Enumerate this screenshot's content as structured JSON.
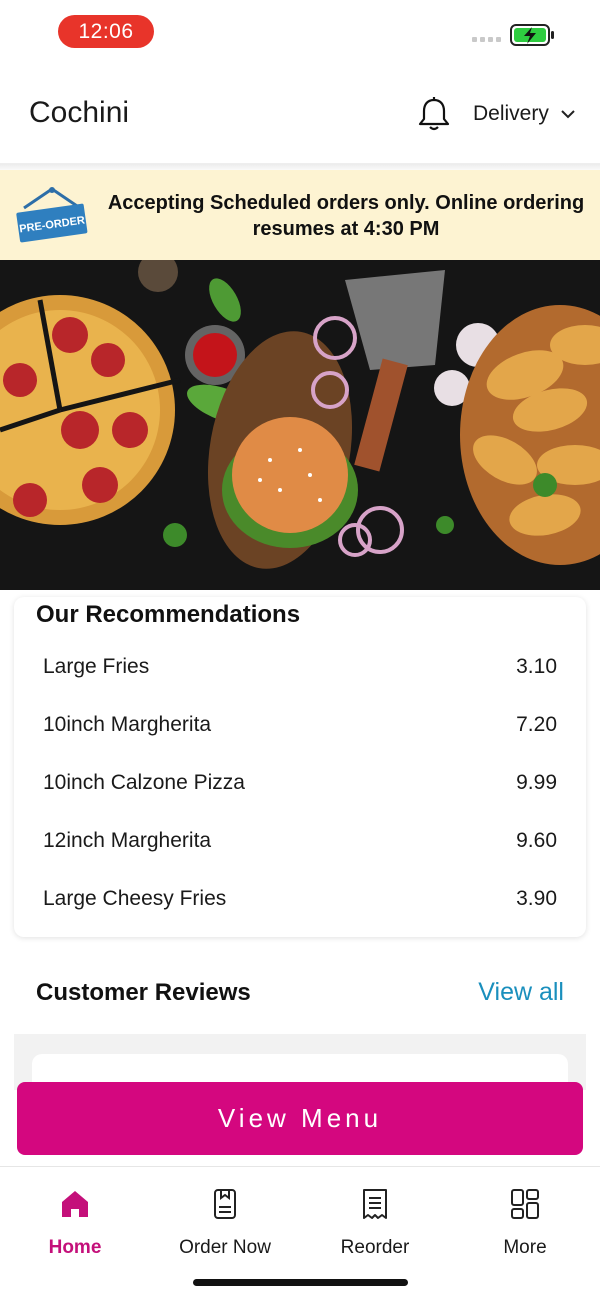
{
  "status_bar": {
    "time": "12:06",
    "battery_icon": "battery-charging-icon"
  },
  "header": {
    "title": "Cochini",
    "bell_icon": "bell-icon",
    "delivery_label": "Delivery",
    "chevron_icon": "chevron-down-icon"
  },
  "banner": {
    "sign_label": "PRE-ORDER",
    "message": "Accepting Scheduled orders only. Online ordering resumes at 4:30 PM"
  },
  "recommendations": {
    "title": "Our Recommendations",
    "items": [
      {
        "name": "Large Fries",
        "price": "3.10"
      },
      {
        "name": "10inch Margherita",
        "price": "7.20"
      },
      {
        "name": "10inch Calzone Pizza",
        "price": "9.99"
      },
      {
        "name": "12inch Margherita",
        "price": "9.60"
      },
      {
        "name": "Large Cheesy Fries",
        "price": "3.90"
      }
    ]
  },
  "reviews": {
    "title": "Customer Reviews",
    "view_all": "View all"
  },
  "cta": {
    "label": "View Menu"
  },
  "nav": {
    "items": [
      {
        "label": "Home",
        "icon": "home-icon"
      },
      {
        "label": "Order Now",
        "icon": "order-icon"
      },
      {
        "label": "Reorder",
        "icon": "receipt-icon"
      },
      {
        "label": "More",
        "icon": "grid-icon"
      }
    ]
  },
  "colors": {
    "accent": "#d4077f",
    "nav_active": "#c4107a",
    "link": "#1a8fbd",
    "banner_bg": "#fdf3d2",
    "status_pill": "#e8342a"
  }
}
